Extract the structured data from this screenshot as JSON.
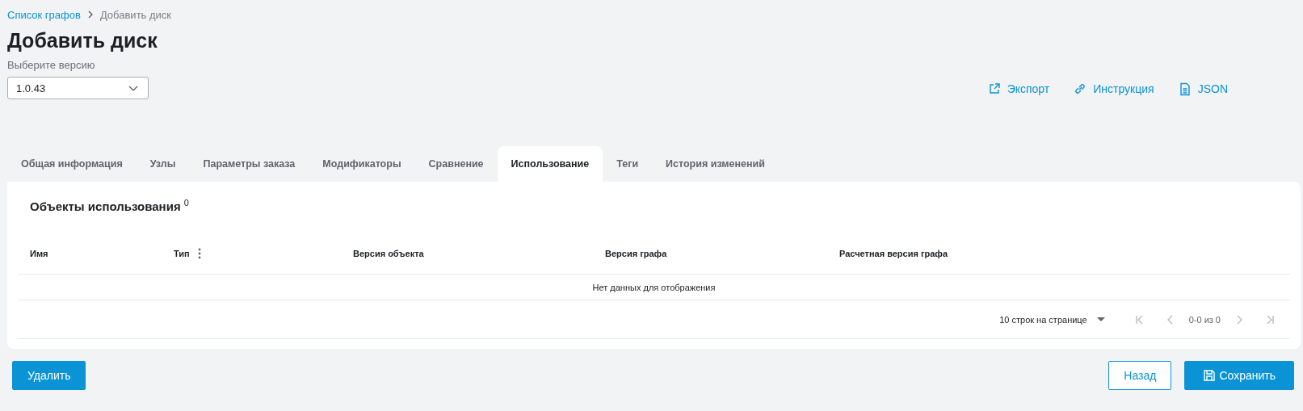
{
  "breadcrumbs": [
    {
      "label": "Список графов",
      "kind": "link"
    },
    {
      "label": "Добавить диск",
      "kind": "current"
    }
  ],
  "title": "Добавить диск",
  "version": {
    "label": "Выберите версию",
    "value": "1.0.43"
  },
  "actions": [
    {
      "label": "Экспорт",
      "kind": "export"
    },
    {
      "label": "Инструкция",
      "kind": "link"
    },
    {
      "label": "JSON",
      "kind": "file"
    }
  ],
  "tabs": [
    {
      "label": "Общая информация",
      "selected": false
    },
    {
      "label": "Узлы",
      "selected": false
    },
    {
      "label": "Параметры заказа",
      "selected": false
    },
    {
      "label": "Модификаторы",
      "selected": false
    },
    {
      "label": "Сравнение",
      "selected": false
    },
    {
      "label": "Использование",
      "selected": true
    },
    {
      "label": "Теги",
      "selected": false
    },
    {
      "label": "История изменений",
      "selected": false
    }
  ],
  "section": {
    "title": "Объекты использования",
    "count": "0"
  },
  "table": {
    "columns": [
      {
        "label": "Имя",
        "menu": false
      },
      {
        "label": "Тип",
        "menu": true
      },
      {
        "label": "Версия объекта",
        "menu": false
      },
      {
        "label": "Версия графа",
        "menu": false
      },
      {
        "label": "Расчетная версия графа",
        "menu": false
      }
    ],
    "empty": "Нет данных для отображения"
  },
  "pagination": {
    "rows_per_page": "10 строк на странице",
    "range": "0-0 из 0",
    "buttons": [
      {
        "kind": "first",
        "disabled": true
      },
      {
        "kind": "prev",
        "disabled": true
      },
      {
        "kind": "next",
        "disabled": true
      },
      {
        "kind": "last",
        "disabled": true
      }
    ]
  },
  "footer": {
    "left": [
      {
        "label": "Удалить",
        "kind": "primary"
      }
    ],
    "right": [
      {
        "label": "Назад",
        "kind": "outline"
      },
      {
        "label": "Сохранить",
        "kind": "save"
      }
    ]
  }
}
